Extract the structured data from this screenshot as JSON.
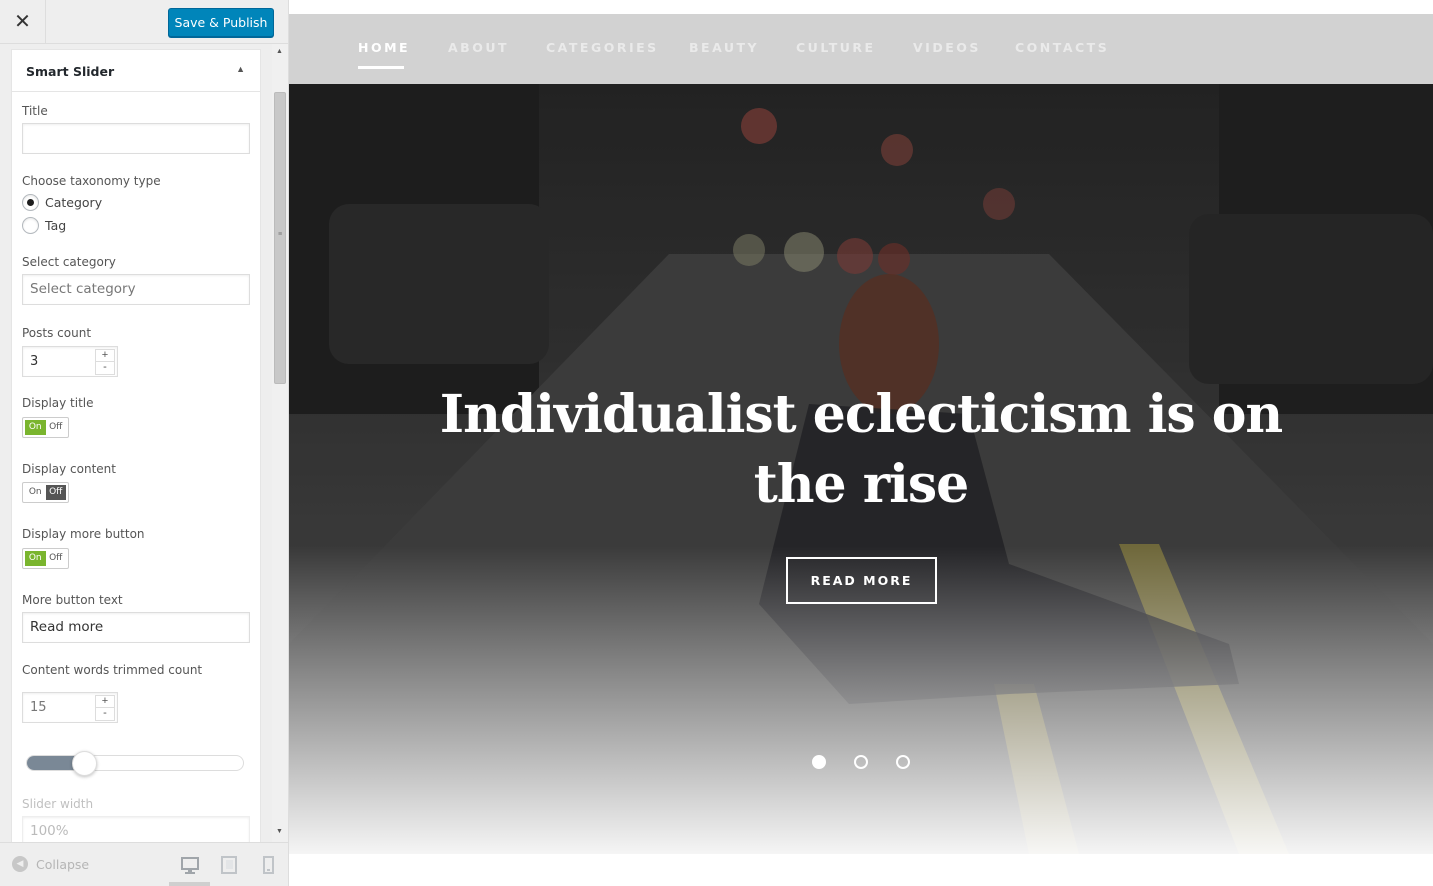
{
  "header": {
    "close_symbol": "✕",
    "save_label": "Save & Publish"
  },
  "widget": {
    "title": "Smart Slider",
    "collapse_arrow": "▲",
    "fields": {
      "title_label": "Title",
      "title_value": "",
      "taxonomy_label": "Choose taxonomy type",
      "taxonomy_options": [
        "Category",
        "Tag"
      ],
      "taxonomy_selected": "Category",
      "category_label": "Select category",
      "category_placeholder": "Select category",
      "posts_count_label": "Posts count",
      "posts_count_value": "3",
      "display_title_label": "Display title",
      "display_title_state": "On",
      "display_content_label": "Display content",
      "display_content_state": "Off",
      "display_more_label": "Display more button",
      "display_more_state": "On",
      "more_text_label": "More button text",
      "more_text_value": "Read more",
      "trim_label": "Content words trimmed count",
      "trim_value": "15",
      "range_value_fraction": 0.25,
      "slider_width_label": "Slider width",
      "slider_width_value": "100%"
    },
    "toggle_on": "On",
    "toggle_off": "Off",
    "spin_plus": "+",
    "spin_minus": "-"
  },
  "footer": {
    "collapse_label": "Collapse",
    "devices": [
      "desktop-icon",
      "tablet-icon",
      "mobile-icon"
    ]
  },
  "preview": {
    "nav": [
      "HOME",
      "ABOUT",
      "CATEGORIES",
      "BEAUTY",
      "CULTURE",
      "VIDEOS",
      "CONTACTS"
    ],
    "nav_active": "HOME",
    "slide_title": "Individualist eclecticism is on the rise",
    "read_more": "READ MORE",
    "slide_count": 3,
    "active_slide": 1
  },
  "colors": {
    "primary_button": "#0085ba",
    "toggle_on": "#7ab52e",
    "toggle_off": "#555555",
    "nav_bar": "#d2d2d2"
  }
}
